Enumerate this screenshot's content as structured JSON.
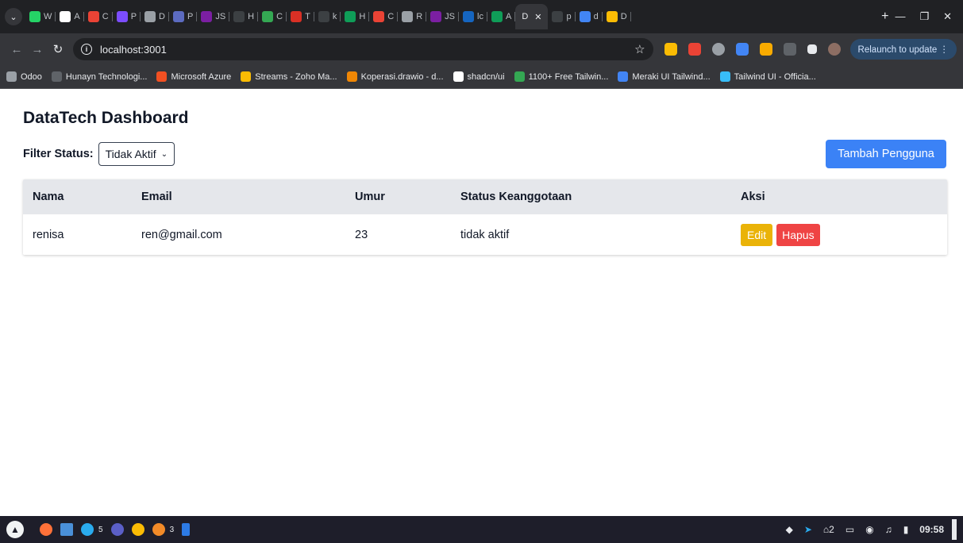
{
  "browser": {
    "tabs": [
      {
        "label": "W",
        "color": "#25d366"
      },
      {
        "label": "A",
        "color": "#ffffff"
      },
      {
        "label": "C",
        "color": "#ea4335"
      },
      {
        "label": "P",
        "color": "#7c4dff"
      },
      {
        "label": "D",
        "color": "#9aa0a6"
      },
      {
        "label": "P",
        "color": "#5c6bc0"
      },
      {
        "label": "JS",
        "color": "#7b1fa2"
      },
      {
        "label": "H",
        "color": "#3c4043"
      },
      {
        "label": "C",
        "color": "#34a853"
      },
      {
        "label": "T",
        "color": "#d93025"
      },
      {
        "label": "k",
        "color": "#3c4043"
      },
      {
        "label": "H",
        "color": "#0f9d58"
      },
      {
        "label": "C",
        "color": "#ea4335"
      },
      {
        "label": "R",
        "color": "#9aa0a6"
      },
      {
        "label": "JS",
        "color": "#7b1fa2"
      },
      {
        "label": "lc",
        "color": "#1565c0"
      },
      {
        "label": "A",
        "color": "#0f9d58"
      }
    ],
    "active_tab": {
      "label": "D"
    },
    "tabs_after": [
      {
        "label": "p",
        "color": "#3c4043"
      },
      {
        "label": "d",
        "color": "#4285f4"
      },
      {
        "label": "D",
        "color": "#fbbc04"
      }
    ],
    "url": "localhost:3001",
    "relaunch_label": "Relaunch to update",
    "bookmarks": [
      {
        "label": "Odoo",
        "color": "#9aa0a6"
      },
      {
        "label": "Hunayn Technologi...",
        "color": "#5f6368"
      },
      {
        "label": "Microsoft Azure",
        "color": "#f25022"
      },
      {
        "label": "Streams - Zoho Ma...",
        "color": "#fbbc04"
      },
      {
        "label": "Koperasi.drawio - d...",
        "color": "#f08705"
      },
      {
        "label": "shadcn/ui",
        "color": "#ffffff"
      },
      {
        "label": "1100+ Free Tailwin...",
        "color": "#34a853"
      },
      {
        "label": "Meraki UI Tailwind...",
        "color": "#4285f4"
      },
      {
        "label": "Tailwind UI - Officia...",
        "color": "#38bdf8"
      }
    ]
  },
  "app": {
    "title": "DataTech Dashboard",
    "filter_label": "Filter Status:",
    "filter_value": "Tidak Aktif",
    "add_button": "Tambah Pengguna",
    "table": {
      "headers": [
        "Nama",
        "Email",
        "Umur",
        "Status Keanggotaan",
        "Aksi"
      ],
      "rows": [
        {
          "nama": "renisa",
          "email": "ren@gmail.com",
          "umur": "23",
          "status": "tidak aktif"
        }
      ],
      "edit_label": "Edit",
      "delete_label": "Hapus"
    }
  },
  "taskbar": {
    "telegram_badge": "5",
    "vscode_badge": "3",
    "tray_notif_count": "2",
    "clock": "09:58"
  }
}
